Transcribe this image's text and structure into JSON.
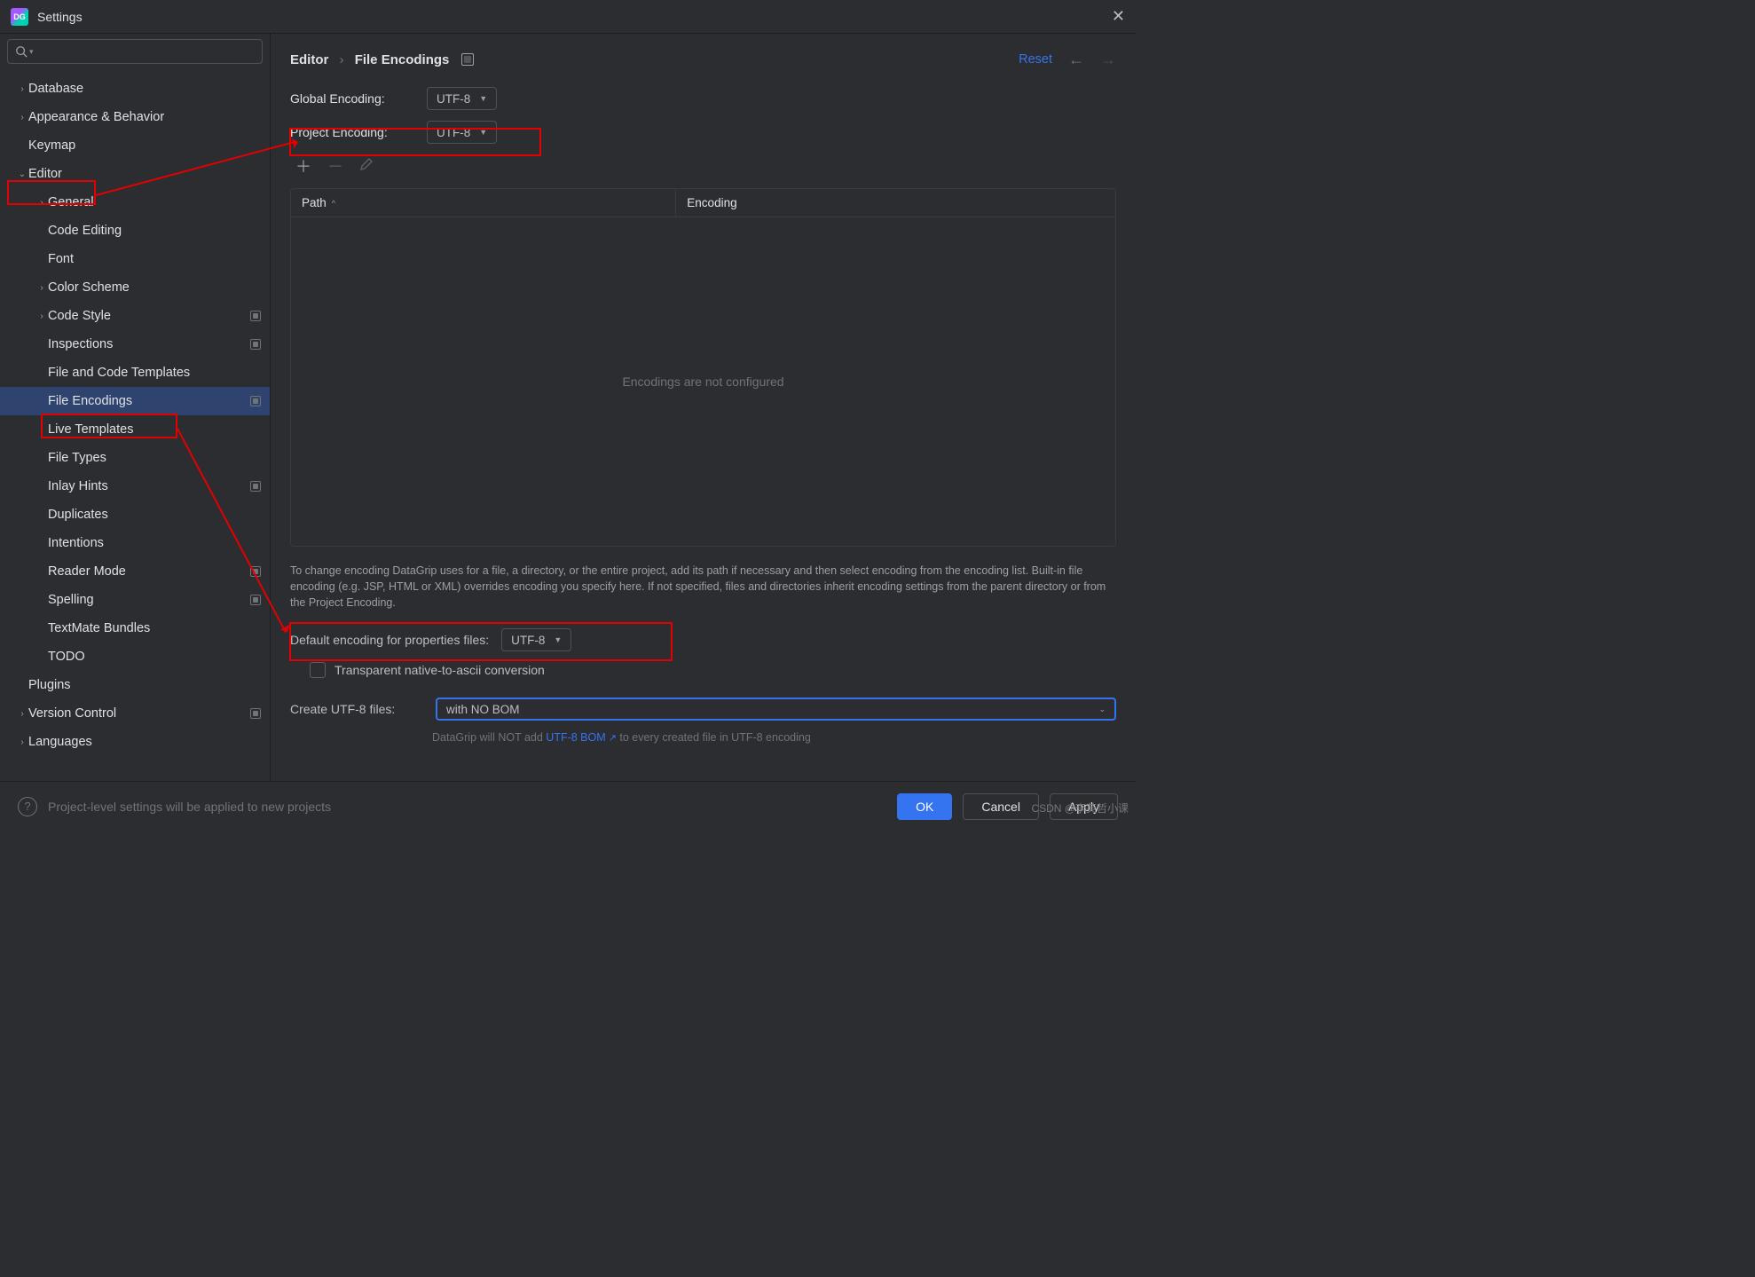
{
  "window": {
    "title": "Settings"
  },
  "sidebar": {
    "search_placeholder": "",
    "items": [
      {
        "label": "Database",
        "depth": 0,
        "arrow": ">",
        "badge": false
      },
      {
        "label": "Appearance & Behavior",
        "depth": 0,
        "arrow": ">",
        "badge": false
      },
      {
        "label": "Keymap",
        "depth": 0,
        "arrow": "",
        "badge": false
      },
      {
        "label": "Editor",
        "depth": 0,
        "arrow": "v",
        "badge": false
      },
      {
        "label": "General",
        "depth": 1,
        "arrow": ">",
        "badge": false
      },
      {
        "label": "Code Editing",
        "depth": 1,
        "arrow": "",
        "badge": false
      },
      {
        "label": "Font",
        "depth": 1,
        "arrow": "",
        "badge": false
      },
      {
        "label": "Color Scheme",
        "depth": 1,
        "arrow": ">",
        "badge": false
      },
      {
        "label": "Code Style",
        "depth": 1,
        "arrow": ">",
        "badge": true
      },
      {
        "label": "Inspections",
        "depth": 1,
        "arrow": "",
        "badge": true
      },
      {
        "label": "File and Code Templates",
        "depth": 1,
        "arrow": "",
        "badge": false
      },
      {
        "label": "File Encodings",
        "depth": 1,
        "arrow": "",
        "badge": true,
        "selected": true
      },
      {
        "label": "Live Templates",
        "depth": 1,
        "arrow": "",
        "badge": false
      },
      {
        "label": "File Types",
        "depth": 1,
        "arrow": "",
        "badge": false
      },
      {
        "label": "Inlay Hints",
        "depth": 1,
        "arrow": "",
        "badge": true
      },
      {
        "label": "Duplicates",
        "depth": 1,
        "arrow": "",
        "badge": false
      },
      {
        "label": "Intentions",
        "depth": 1,
        "arrow": "",
        "badge": false
      },
      {
        "label": "Reader Mode",
        "depth": 1,
        "arrow": "",
        "badge": true
      },
      {
        "label": "Spelling",
        "depth": 1,
        "arrow": "",
        "badge": true
      },
      {
        "label": "TextMate Bundles",
        "depth": 1,
        "arrow": "",
        "badge": false
      },
      {
        "label": "TODO",
        "depth": 1,
        "arrow": "",
        "badge": false
      },
      {
        "label": "Plugins",
        "depth": 0,
        "arrow": "",
        "badge": false
      },
      {
        "label": "Version Control",
        "depth": 0,
        "arrow": ">",
        "badge": true
      },
      {
        "label": "Languages",
        "depth": 0,
        "arrow": ">",
        "badge": false
      }
    ]
  },
  "header": {
    "crumb1": "Editor",
    "crumb2": "File Encodings",
    "reset": "Reset"
  },
  "panel": {
    "global_encoding_label": "Global Encoding:",
    "global_encoding_value": "UTF-8",
    "project_encoding_label": "Project Encoding:",
    "project_encoding_value": "UTF-8",
    "table": {
      "col_path": "Path",
      "col_encoding": "Encoding",
      "empty": "Encodings are not configured"
    },
    "help": "To change encoding DataGrip uses for a file, a directory, or the entire project, add its path if necessary and then select encoding from the encoding list. Built-in file encoding (e.g. JSP, HTML or XML) overrides encoding you specify here. If not specified, files and directories inherit encoding settings from the parent directory or from the Project Encoding.",
    "props_label": "Default encoding for properties files:",
    "props_value": "UTF-8",
    "transparent_label": "Transparent native-to-ascii conversion",
    "create_label": "Create UTF-8 files:",
    "create_value": "with NO BOM",
    "hint_prefix": "DataGrip will NOT add ",
    "hint_link": "UTF-8 BOM",
    "hint_suffix": " to every created file in UTF-8 encoding"
  },
  "footer": {
    "note": "Project-level settings will be applied to new projects",
    "ok": "OK",
    "cancel": "Cancel",
    "apply": "Apply"
  },
  "watermark": "CSDN @李英哲小课"
}
